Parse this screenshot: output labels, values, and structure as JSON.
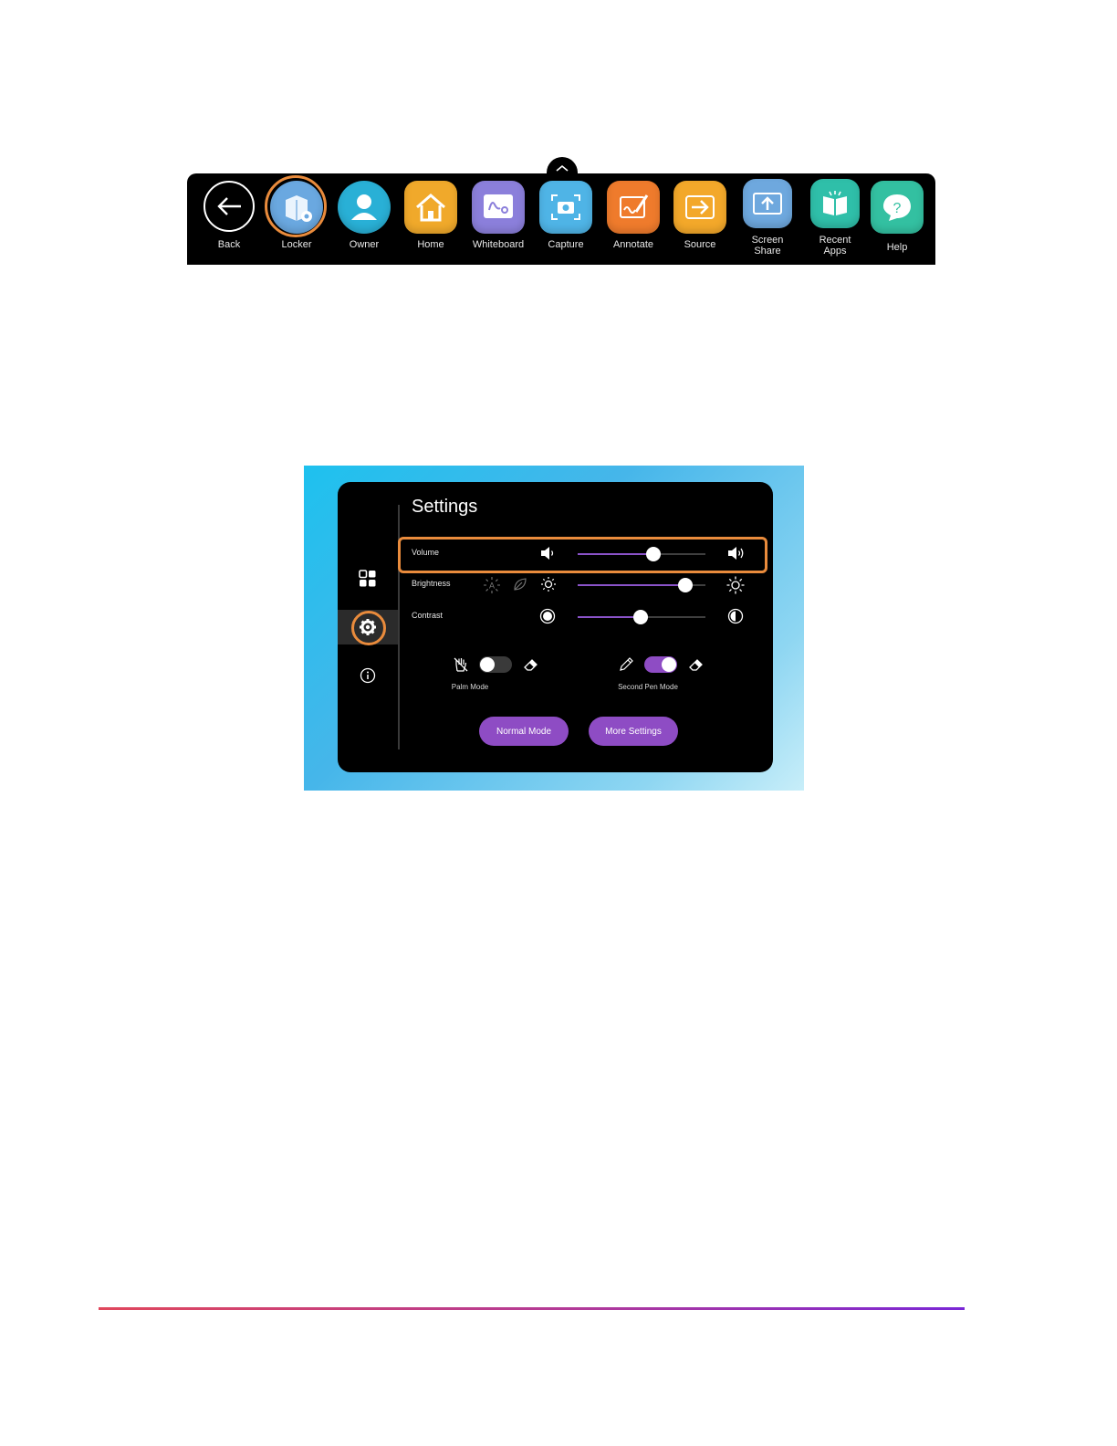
{
  "toolbar": {
    "items": [
      {
        "label": "Back",
        "icon": "back-arrow-icon",
        "color": "#000000"
      },
      {
        "label": "Locker",
        "icon": "locker-icon",
        "color": "#6aa8e0"
      },
      {
        "label": "Owner",
        "icon": "owner-icon",
        "color": "#29b0d6"
      },
      {
        "label": "Home",
        "icon": "home-icon",
        "color": "#f0a92b"
      },
      {
        "label": "Whiteboard",
        "icon": "whiteboard-icon",
        "color": "#8b7fdb"
      },
      {
        "label": "Capture",
        "icon": "capture-icon",
        "color": "#4fb4e6"
      },
      {
        "label": "Annotate",
        "icon": "annotate-icon",
        "color": "#ef7b2c"
      },
      {
        "label": "Source",
        "icon": "source-icon",
        "color": "#f3a82a"
      },
      {
        "label": "Screen\nShare",
        "icon": "screen-share-icon",
        "color": "#6ea8de"
      },
      {
        "label": "Recent\nApps",
        "icon": "recent-apps-icon",
        "color": "#2fbfa9"
      },
      {
        "label": "Help",
        "icon": "help-icon",
        "color": "#33c0a1"
      }
    ],
    "highlighted": "Locker",
    "highlight_color": "#e98b3c"
  },
  "settings": {
    "title": "Settings",
    "rail": [
      "apps-grid-icon",
      "gear-icon",
      "info-icon"
    ],
    "active_rail": "gear-icon",
    "volume": {
      "label": "Volume",
      "level": 0.59
    },
    "brightness": {
      "label": "Brightness",
      "level": 0.84
    },
    "contrast": {
      "label": "Contrast",
      "level": 0.49
    },
    "palm_mode": {
      "label": "Palm Mode",
      "on": false
    },
    "second_pen_mode": {
      "label": "Second Pen Mode",
      "on": true
    },
    "buttons": {
      "normal_mode": "Normal Mode",
      "more_settings": "More Settings"
    },
    "accent_color": "#8e4cc4",
    "highlight_color": "#e98b3c"
  }
}
